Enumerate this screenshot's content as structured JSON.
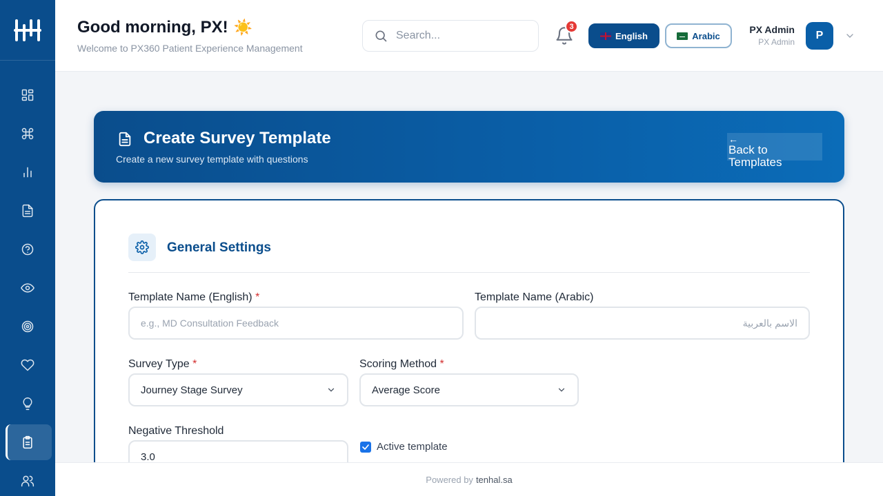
{
  "header": {
    "greeting": "Good morning, PX!",
    "greeting_emoji": "☀️",
    "subtitle": "Welcome to PX360 Patient Experience Management",
    "search_placeholder": "Search...",
    "notifications_count": "3",
    "lang_english": "English",
    "lang_arabic": "Arabic",
    "user_name": "PX Admin",
    "user_role": "PX Admin",
    "avatar_initial": "P"
  },
  "sidebar": {
    "items": [
      {
        "icon": "dashboard-icon"
      },
      {
        "icon": "command-icon"
      },
      {
        "icon": "bar-chart-icon"
      },
      {
        "icon": "document-icon"
      },
      {
        "icon": "help-circle-icon"
      },
      {
        "icon": "eye-icon"
      },
      {
        "icon": "target-icon"
      },
      {
        "icon": "heart-icon"
      },
      {
        "icon": "lightbulb-icon"
      },
      {
        "icon": "clipboard-icon",
        "active": true
      },
      {
        "icon": "users-icon"
      }
    ]
  },
  "banner": {
    "title": "Create Survey Template",
    "subtitle": "Create a new survey template with questions",
    "back_arrow": "←",
    "back_label": "Back to Templates"
  },
  "form": {
    "section_title": "General Settings",
    "name_en_label": "Template Name (English)",
    "name_en_placeholder": "e.g., MD Consultation Feedback",
    "name_ar_label": "Template Name (Arabic)",
    "name_ar_placeholder": "الاسم بالعربية",
    "survey_type_label": "Survey Type",
    "survey_type_value": "Journey Stage Survey",
    "scoring_label": "Scoring Method",
    "scoring_value": "Average Score",
    "threshold_label": "Negative Threshold",
    "threshold_value": "3.0",
    "active_label": "Active template",
    "required_mark": "*"
  },
  "footer": {
    "powered_by": "Powered by",
    "brand": "tenhal.sa"
  },
  "colors": {
    "primary": "#0a4d8c",
    "accent": "#0a5fa8",
    "badge": "#e53935",
    "required": "#d32f2f"
  }
}
